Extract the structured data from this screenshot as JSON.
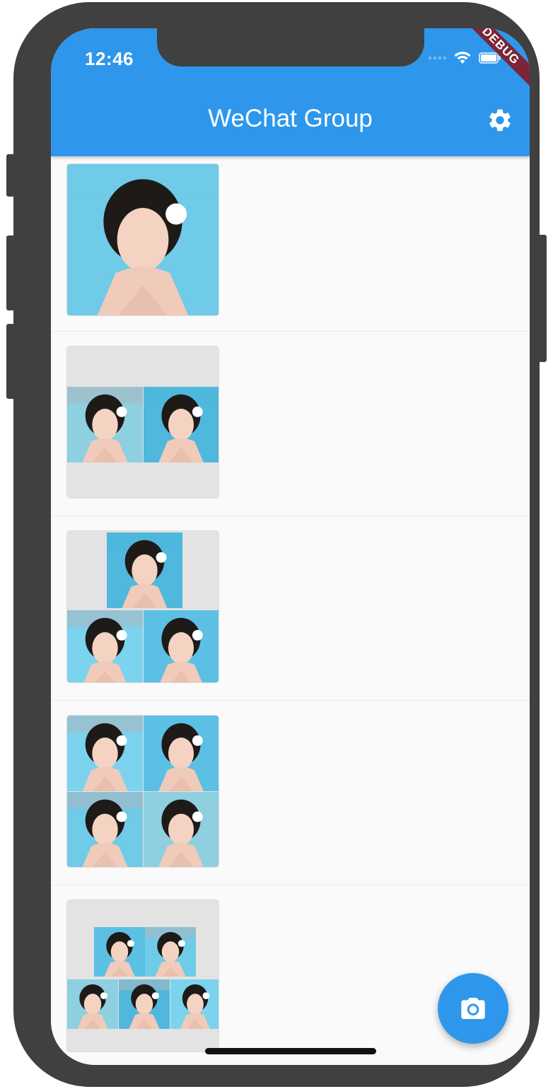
{
  "status_bar": {
    "time": "12:46"
  },
  "app_bar": {
    "title": "WeChat Group",
    "settings_icon": "gear-icon"
  },
  "debug_banner": "DEBUG",
  "groups": [
    {
      "photo_count": 1
    },
    {
      "photo_count": 2
    },
    {
      "photo_count": 3
    },
    {
      "photo_count": 4
    },
    {
      "photo_count": 5
    }
  ],
  "fab": {
    "icon": "camera-icon"
  },
  "colors": {
    "primary": "#2e97ec",
    "debug": "#7a2638",
    "background": "#fafafa"
  }
}
